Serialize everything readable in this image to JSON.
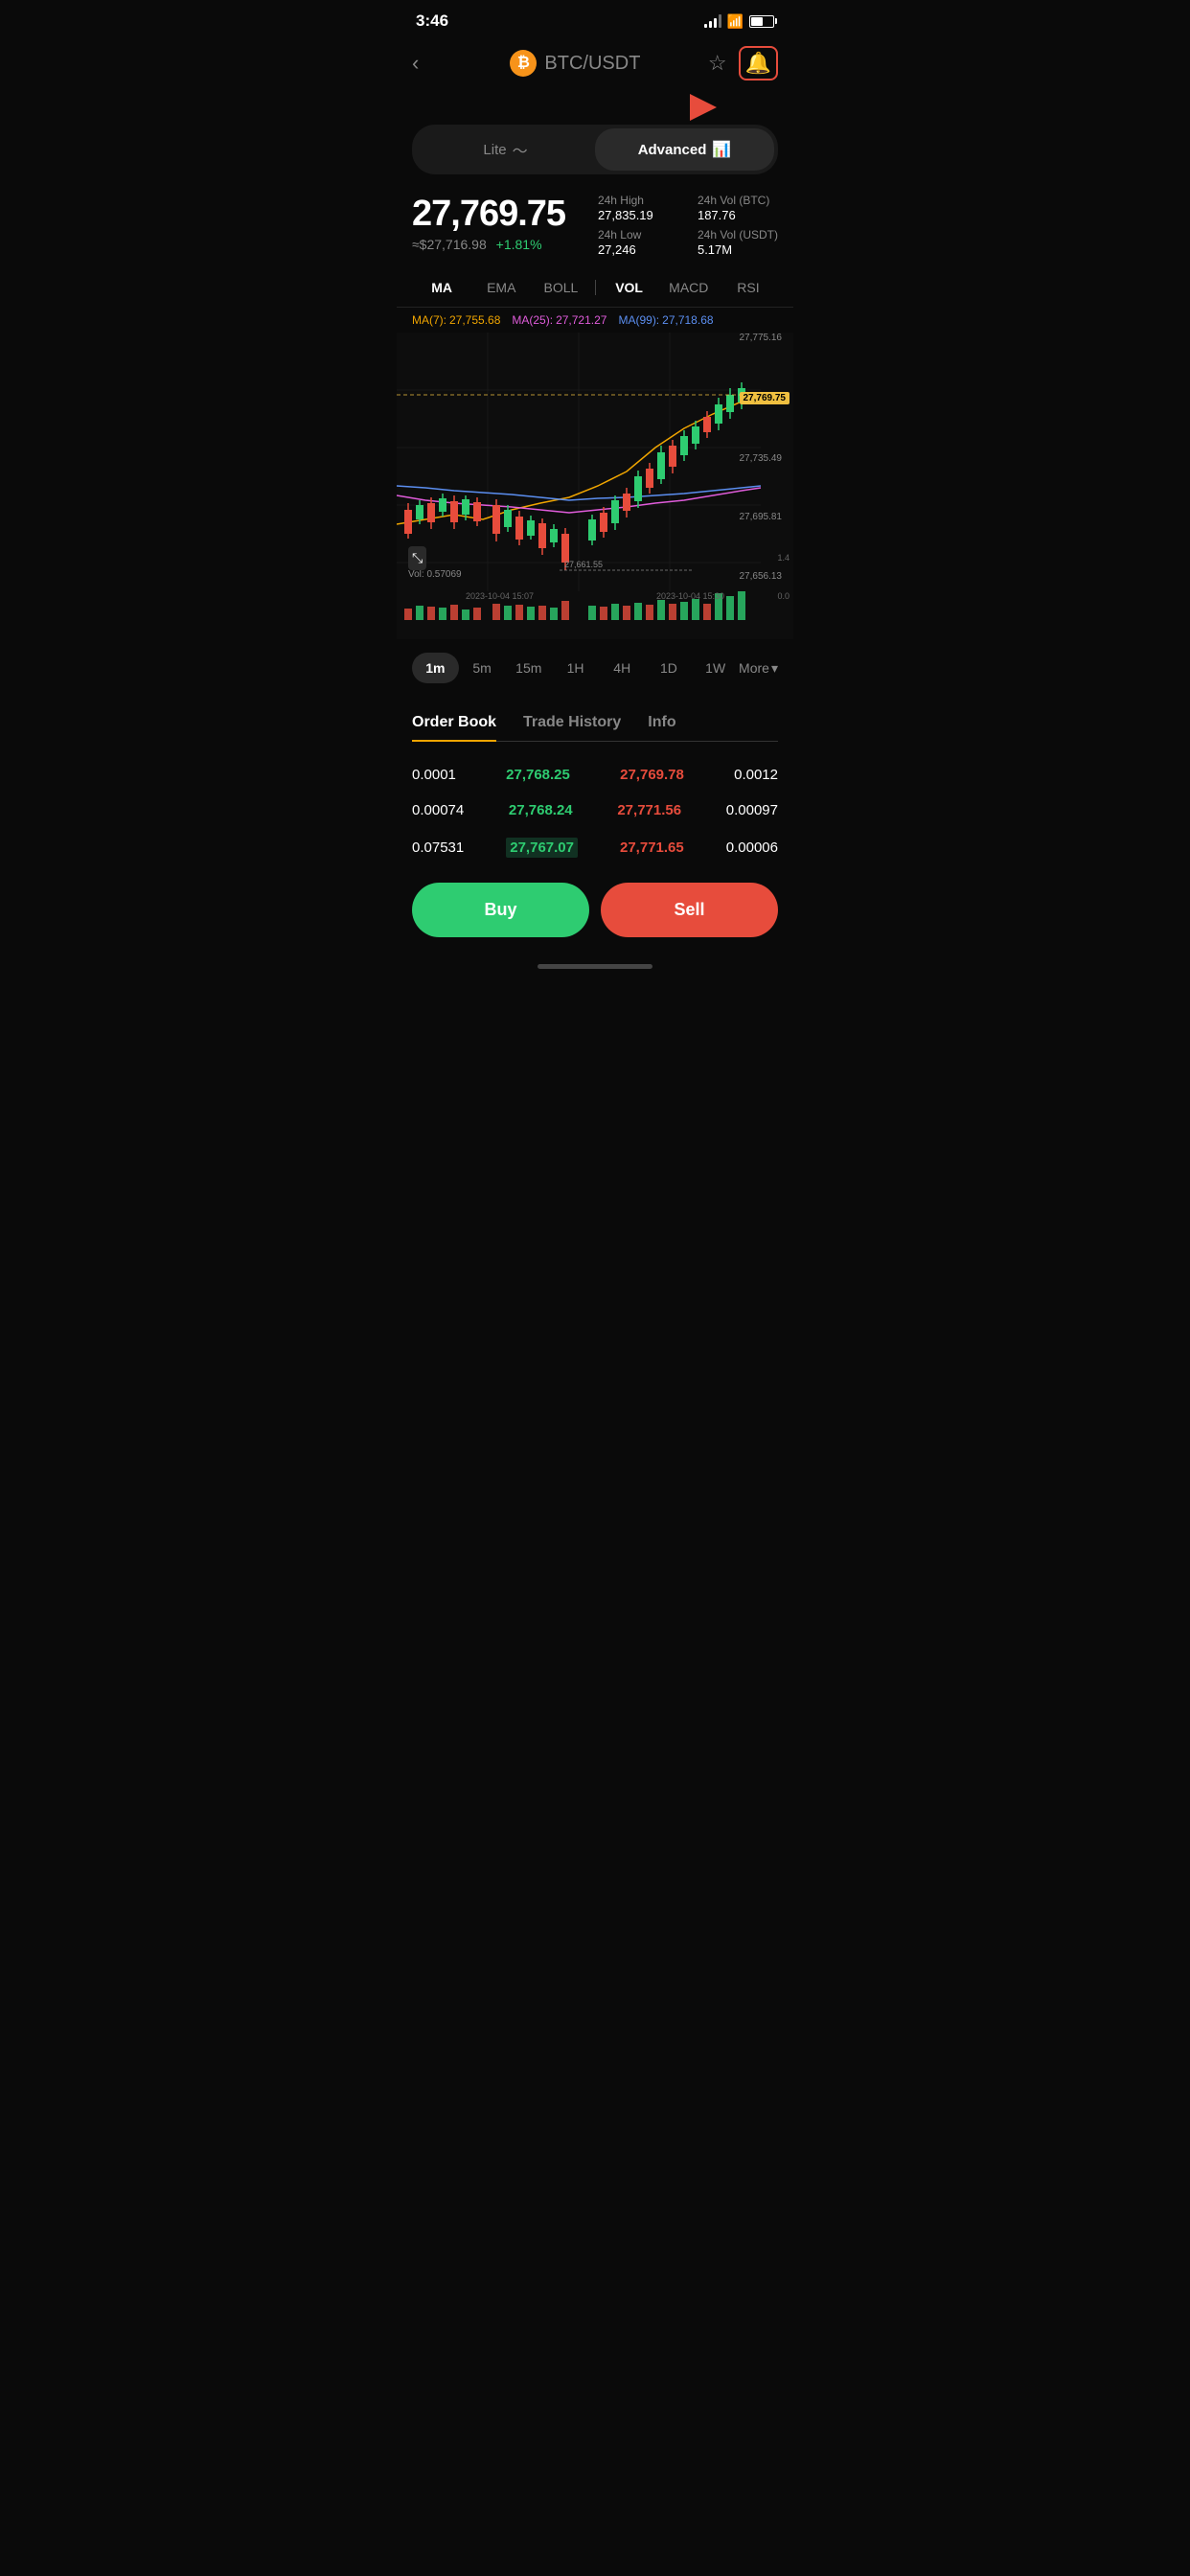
{
  "statusBar": {
    "time": "3:46",
    "battery": 55
  },
  "header": {
    "backLabel": "‹",
    "coin": "BTC",
    "pair": "USDT",
    "title": "BTC/USDT"
  },
  "modes": {
    "lite": "Lite",
    "advanced": "Advanced"
  },
  "price": {
    "main": "27,769.75",
    "usd": "≈$27,716.98",
    "change": "+1.81%",
    "high24h_label": "24h High",
    "high24h": "27,835.19",
    "low24h_label": "24h Low",
    "low24h": "27,246",
    "vol_btc_label": "24h Vol (BTC)",
    "vol_btc": "187.76",
    "vol_usdt_label": "24h Vol (USDT)",
    "vol_usdt": "5.17M"
  },
  "indicators": [
    "MA",
    "EMA",
    "BOLL",
    "VOL",
    "MACD",
    "RSI"
  ],
  "ma_legend": [
    {
      "label": "MA(7):",
      "value": "27,755.68",
      "color": "#f0a500"
    },
    {
      "label": "MA(25):",
      "value": "27,721.27",
      "color": "#e05cdb"
    },
    {
      "label": "MA(99):",
      "value": "27,718.68",
      "color": "#5b8ef0"
    }
  ],
  "chart": {
    "min_label": "27,661.55",
    "price_labels": [
      "27,775.16",
      "27,769.75",
      "27,735.49",
      "27,695.81",
      "27,656.13"
    ],
    "current_price": "27,769.75",
    "vol_label": "Vol: 0.57069",
    "vol_axis": [
      "1.4",
      "0.0"
    ],
    "time_labels": [
      "2023-10-04 15:07",
      "2023-10-04 15:30"
    ]
  },
  "timeframes": [
    "1m",
    "5m",
    "15m",
    "1H",
    "4H",
    "1D",
    "1W"
  ],
  "more_label": "More",
  "orderBook": {
    "tabs": [
      "Order Book",
      "Trade History",
      "Info"
    ],
    "rows": [
      {
        "qty": "0.0001",
        "bid": "27,768.25",
        "ask": "27,769.78",
        "qty_right": "0.0012"
      },
      {
        "qty": "0.00074",
        "bid": "27,768.24",
        "ask": "27,771.56",
        "qty_right": "0.00097"
      },
      {
        "qty": "0.07531",
        "bid": "27,767.07",
        "ask": "27,771.65",
        "qty_right": "0.00006",
        "highlight_bid": true
      }
    ]
  },
  "buttons": {
    "buy": "Buy",
    "sell": "Sell"
  }
}
